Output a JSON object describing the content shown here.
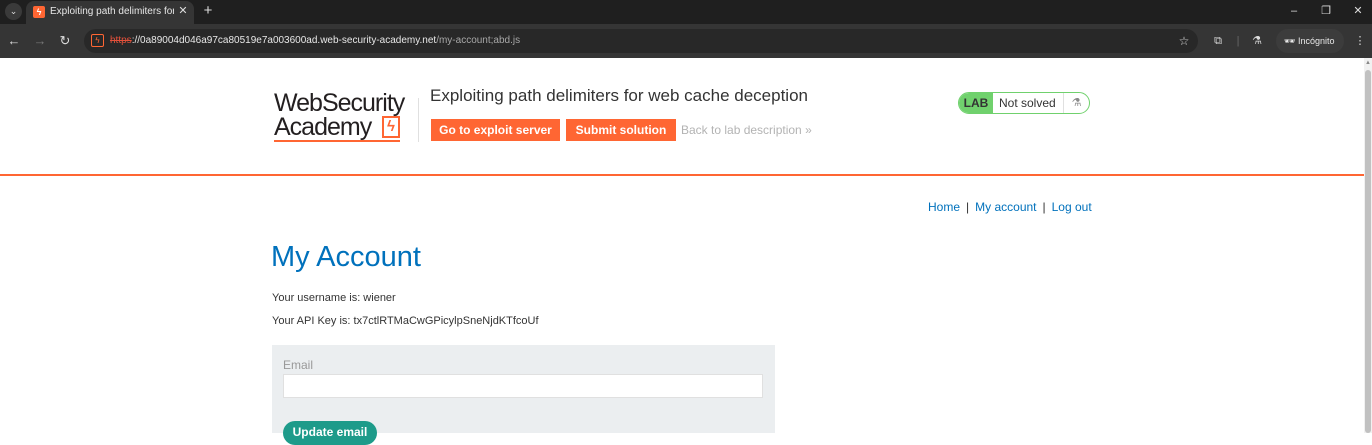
{
  "browser": {
    "tab_title": "Exploiting path delimiters for w",
    "url_scheme": "https",
    "url_host_part": "://0a89004d046a97ca80519e7a003600ad.web-security-academy.net",
    "url_path": "/my-account;abd.js",
    "incognito_label": "Incógnito"
  },
  "header": {
    "logo_line1": "WebSecurity",
    "logo_line2": "Academy",
    "lab_title": "Exploiting path delimiters for web cache deception",
    "exploit_button": "Go to exploit server",
    "submit_button": "Submit solution",
    "back_link": "Back to lab description",
    "lab_badge": "LAB",
    "status": "Not solved",
    "accent_color": "#ff6633",
    "status_color": "#70d16d"
  },
  "nav": {
    "home": "Home",
    "separator": "|",
    "my_account": "My account",
    "log_out": "Log out"
  },
  "main": {
    "title": "My Account",
    "username_line": "Your username is: wiener",
    "api_key_line": "Your API Key is: tx7ctlRTMaCwGPicylpSneNjdKTfcoUf",
    "email_label": "Email",
    "email_value": "",
    "update_button": "Update email"
  }
}
